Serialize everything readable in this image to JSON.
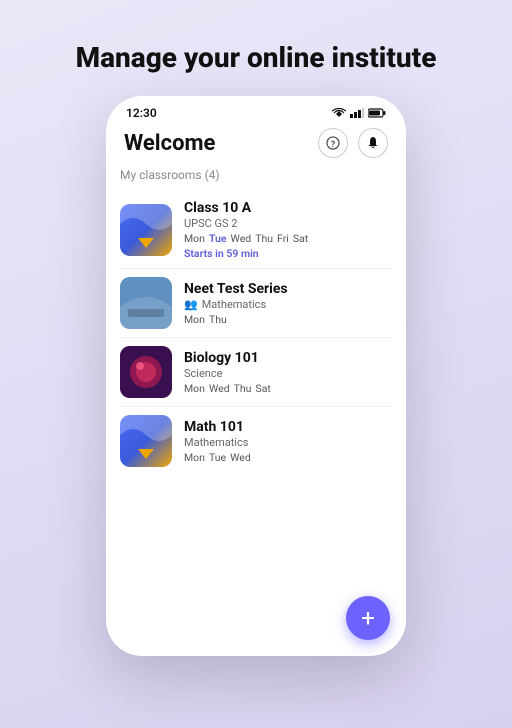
{
  "page": {
    "heading": "Manage your online institute"
  },
  "status_bar": {
    "time": "12:30"
  },
  "app_header": {
    "title": "Welcome"
  },
  "section": {
    "label": "My classrooms (4)"
  },
  "classrooms": [
    {
      "id": "class10a",
      "name": "Class 10 A",
      "subtitle": "UPSC GS 2",
      "days": [
        "Mon",
        "Tue",
        "Wed",
        "Thu",
        "Fri",
        "Sat"
      ],
      "active_days": [
        "Tue"
      ],
      "badge": "Starts in 59 min",
      "thumb_type": "class10"
    },
    {
      "id": "neet",
      "name": "Neet Test Series",
      "subtitle": "Mathematics",
      "has_people_icon": true,
      "days": [
        "Mon",
        "Thu"
      ],
      "active_days": [],
      "badge": "",
      "thumb_type": "neet"
    },
    {
      "id": "bio101",
      "name": "Biology 101",
      "subtitle": "Science",
      "has_people_icon": false,
      "days": [
        "Mon",
        "Wed",
        "Thu",
        "Sat"
      ],
      "active_days": [],
      "badge": "",
      "thumb_type": "bio"
    },
    {
      "id": "math101",
      "name": "Math 101",
      "subtitle": "Mathematics",
      "has_people_icon": false,
      "days": [
        "Mon",
        "Tue",
        "Wed"
      ],
      "active_days": [],
      "badge": "",
      "thumb_type": "math"
    }
  ],
  "fab": {
    "label": "+"
  }
}
